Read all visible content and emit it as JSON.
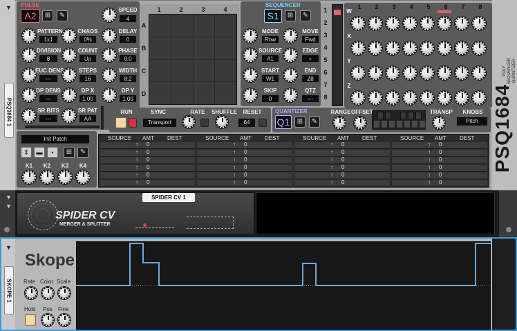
{
  "rack_labels": {
    "psq": "PSQ1684 1",
    "skope": "SKOPE 1"
  },
  "brand": {
    "name": "PSQ1684",
    "sub1": "POLY",
    "sub2": "SEQUENCER",
    "sub3": "QUANTIZER"
  },
  "pulse": {
    "title": "PULSE",
    "patch": "A2",
    "knobs": {
      "speed": {
        "label": "SPEED",
        "value": "4"
      },
      "pattern": {
        "label": "PATTERN",
        "value": "1x1"
      },
      "chaos": {
        "label": "CHAOS",
        "value": "0%"
      },
      "delay": {
        "label": "DELAY",
        "value": "0"
      },
      "division": {
        "label": "DIVISION",
        "value": "8"
      },
      "count": {
        "label": "COUNT",
        "value": "Up"
      },
      "phase": {
        "label": "PHASE",
        "value": "0.0"
      },
      "eucdens": {
        "label": "EUC DENS",
        "value": "---"
      },
      "steps": {
        "label": "STEPS",
        "value": "16"
      },
      "width": {
        "label": "WIDTH",
        "value": "8:2"
      },
      "dpdens": {
        "label": "DP DENS",
        "value": "---"
      },
      "dpx": {
        "label": "DP X",
        "value": "1.00"
      },
      "dpy": {
        "label": "DP Y",
        "value": "1.00"
      },
      "srbits": {
        "label": "SR BITS",
        "value": "---"
      },
      "srpat": {
        "label": "SR PAT",
        "value": "AA"
      }
    }
  },
  "grid": {
    "cols": [
      "1",
      "2",
      "3",
      "4"
    ],
    "rows": [
      "A",
      "B",
      "C",
      "D"
    ]
  },
  "sequencer": {
    "title": "SEQUENCER",
    "patch": "S1",
    "knobs": {
      "mode": {
        "label": "MODE",
        "value": "Row"
      },
      "move": {
        "label": "MOVE",
        "value": "Fwd"
      },
      "source": {
        "label": "SOURCE",
        "value": "A1"
      },
      "edge": {
        "label": "EDGE",
        "value": "+"
      },
      "start": {
        "label": "START",
        "value": "W1"
      },
      "end": {
        "label": "END",
        "value": "Z8"
      },
      "skip": {
        "label": "SKIP",
        "value": "0"
      },
      "qtz": {
        "label": "QTZ",
        "value": "---"
      }
    }
  },
  "vert_nums": [
    "1",
    "2",
    "3",
    "4",
    "5",
    "6",
    "7",
    "8"
  ],
  "steps": {
    "cols": [
      "1",
      "2",
      "3",
      "4",
      "5",
      "6",
      "7",
      "8"
    ],
    "rows": [
      "W",
      "X",
      "Y",
      "Z"
    ]
  },
  "transport": {
    "run": "RUN",
    "sync": "SYNC",
    "sync_value": "Transport",
    "rate": "RATE",
    "shuffle": "SHUFFLE",
    "reset": "RESET",
    "reset_value": "64"
  },
  "quantizer": {
    "title": "QUANTIZER",
    "patch": "Q1",
    "range": "RANGE",
    "offset": "OFFSET",
    "transp": "TRANSP",
    "knobs_label": "KNOBS",
    "knobs_value": "Pitch"
  },
  "patch": {
    "name": "Init Patch",
    "k1": "K1",
    "k2": "K2",
    "k3": "K3",
    "k4": "K4"
  },
  "matrix": {
    "headers": [
      "SOURCE",
      "AMT",
      "DEST"
    ],
    "amt": "0",
    "arrow": "↑"
  },
  "spider": {
    "tag": "SPIDER CV 1",
    "title": "SPIDER CV",
    "subtitle": "MERGER & SPLITTER"
  },
  "skope": {
    "title": "Skope",
    "rate": "Rate",
    "color": "Color",
    "scale": "Scale",
    "hold": "Hold",
    "pos": "Pos",
    "fine": "Fine"
  }
}
